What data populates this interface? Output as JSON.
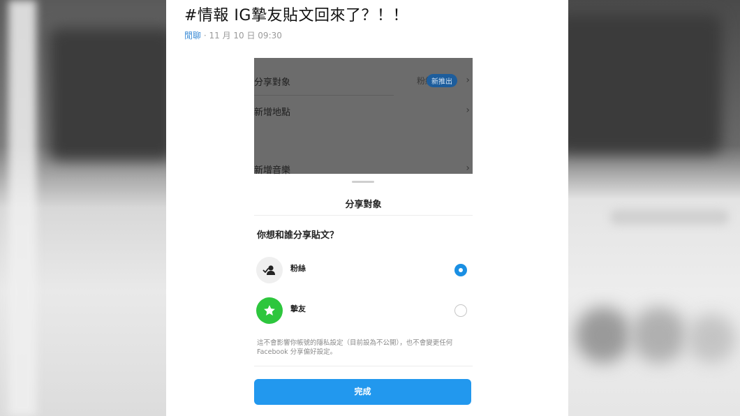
{
  "article": {
    "title": "#情報 IG摯友貼文回來了？！！",
    "category": "閒聊",
    "separator": "·",
    "date": "11 月 10 日 09:30"
  },
  "screenshot": {
    "bg_rows": [
      {
        "label": "分享對象",
        "value": "粉絲",
        "badge": "新推出"
      },
      {
        "label": "新增地點"
      },
      {
        "label": "新增音樂"
      }
    ],
    "sheet_title": "分享對象",
    "question": "你想和誰分享貼文？",
    "options": [
      {
        "label": "粉絲",
        "icon": "followers-icon",
        "selected": true
      },
      {
        "label": "摯友",
        "icon": "star-icon",
        "selected": false
      }
    ],
    "note": "這不會影響你帳號的隱私設定（目前設為不公開），也不會變更任何 Facebook 分享偏好設定。",
    "done_label": "完成"
  },
  "colors": {
    "accent": "#2298ee",
    "close_friends_green": "#2dc63d",
    "category_link": "#3a8bd6"
  }
}
